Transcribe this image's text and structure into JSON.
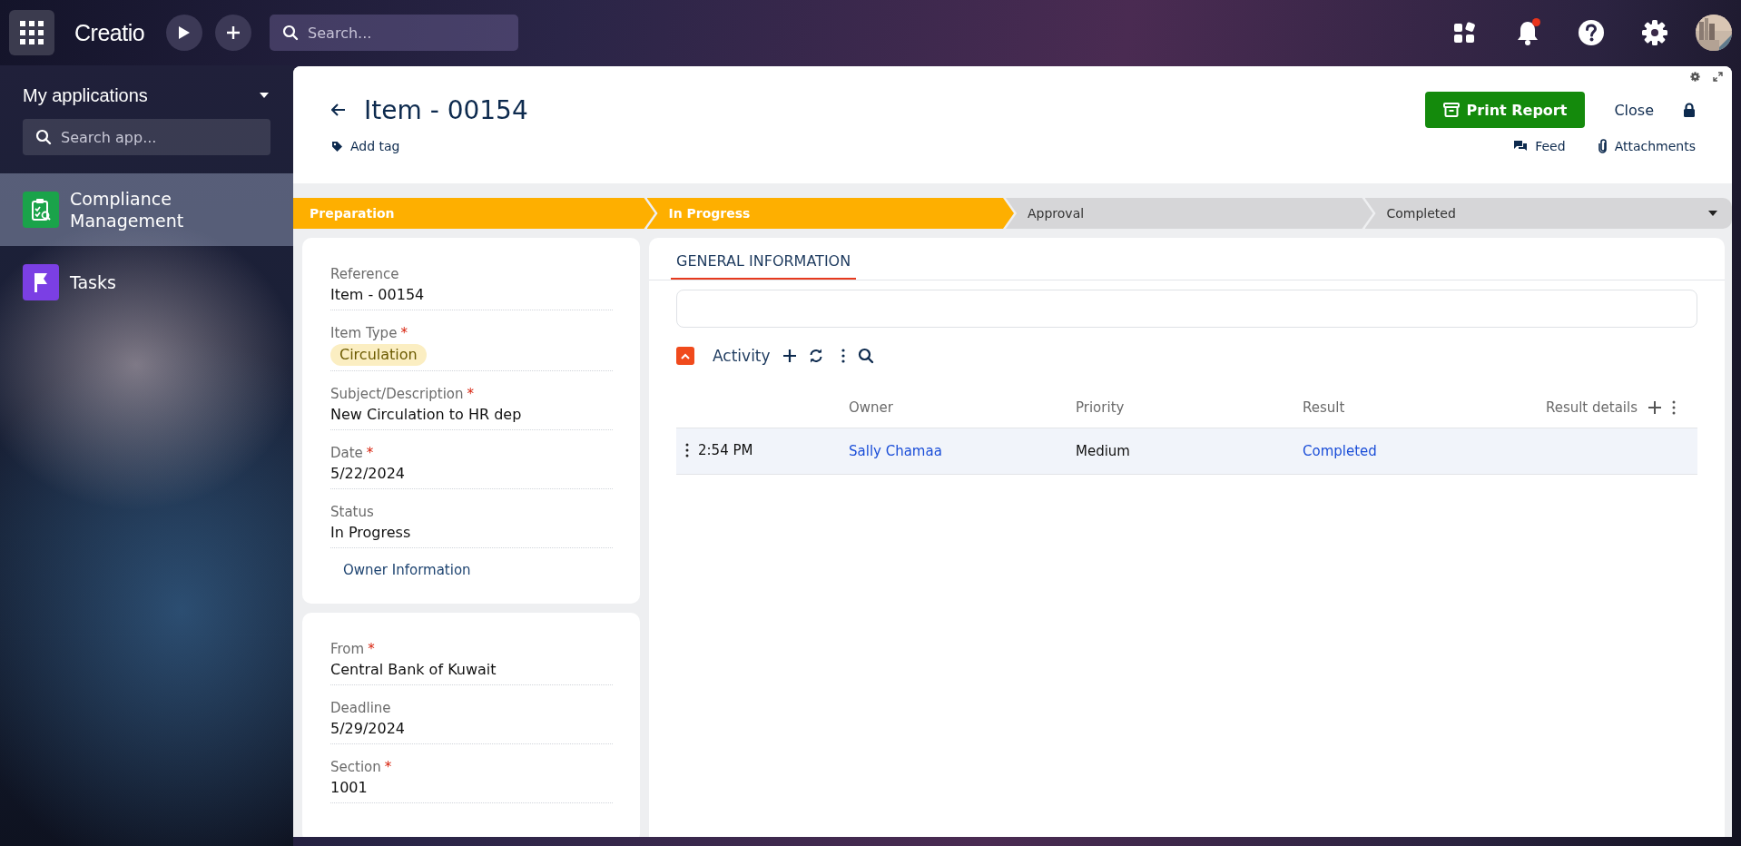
{
  "topbar": {
    "logo": "Creatio",
    "search_placeholder": "Search...",
    "notifications_unread": true
  },
  "sidebar": {
    "title": "My applications",
    "search_placeholder": "Search app...",
    "items": [
      {
        "label": "Compliance Management",
        "selected": true,
        "color": "#1aa34a",
        "kind": "clipboard"
      },
      {
        "label": "Tasks",
        "selected": false,
        "color": "#7b3fe4",
        "kind": "flag"
      }
    ]
  },
  "record": {
    "title": "Item - 00154",
    "add_tag": "Add tag",
    "print_button": "Print Report",
    "close_button": "Close",
    "feed": "Feed",
    "attachments": "Attachments"
  },
  "stages": [
    {
      "label": "Preparation",
      "reached": true
    },
    {
      "label": "In Progress",
      "reached": true
    },
    {
      "label": "Approval",
      "reached": false
    },
    {
      "label": "Completed",
      "reached": false
    }
  ],
  "field_groups": [
    {
      "fields": [
        {
          "label": "Reference",
          "value": "Item - 00154",
          "kind": "text"
        },
        {
          "label": "Item Type",
          "required_mark": "*",
          "value": "Circulation",
          "kind": "tag"
        },
        {
          "label": "Subject/Description",
          "required_mark": "*",
          "value": "New Circulation to HR dep",
          "kind": "text"
        },
        {
          "label": "Date",
          "required_mark": "*",
          "value": "5/22/2024",
          "kind": "text"
        },
        {
          "label": "Status",
          "value": "In Progress",
          "kind": "text"
        }
      ],
      "link": "Owner Information"
    },
    {
      "fields": [
        {
          "label": "From",
          "required_mark": "*",
          "value": "Central Bank of Kuwait",
          "kind": "text"
        },
        {
          "label": "Deadline",
          "value": "5/29/2024",
          "kind": "text"
        },
        {
          "label": "Section",
          "required_mark": "*",
          "value": "1001",
          "kind": "text"
        }
      ]
    }
  ],
  "tabs": [
    {
      "label": "GENERAL INFORMATION",
      "selected": true
    }
  ],
  "activity": {
    "title": "Activity",
    "expanded": true,
    "columns": [
      "Owner",
      "Priority",
      "Result",
      "Result details"
    ],
    "rows": [
      {
        "column_1": "2:54 PM",
        "owner": "Sally Chamaa",
        "priority": "Medium",
        "result": "Completed",
        "selected": true
      }
    ]
  }
}
